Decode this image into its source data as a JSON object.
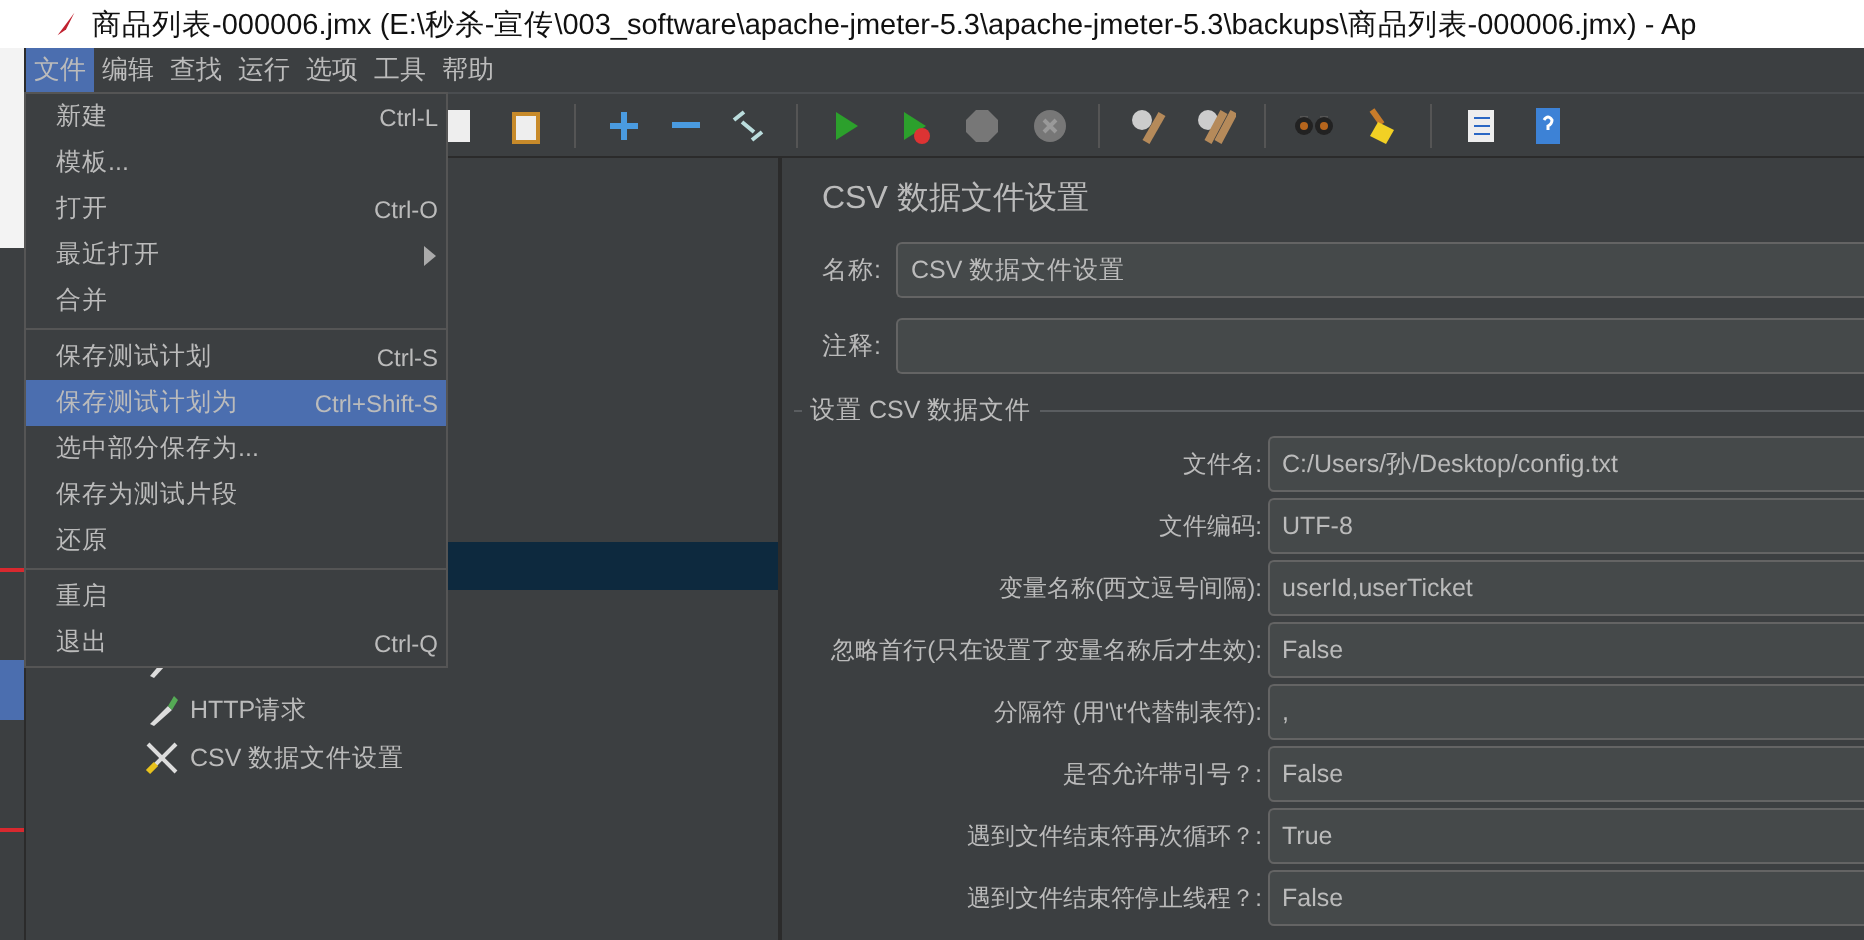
{
  "window": {
    "title": "商品列表-000006.jmx (E:\\秒杀-宣传\\003_software\\apache-jmeter-5.3\\apache-jmeter-5.3\\backups\\商品列表-000006.jmx) - Ap"
  },
  "menubar": [
    {
      "label": "文件",
      "selected": true
    },
    {
      "label": "编辑",
      "selected": false
    },
    {
      "label": "查找",
      "selected": false
    },
    {
      "label": "运行",
      "selected": false
    },
    {
      "label": "选项",
      "selected": false
    },
    {
      "label": "工具",
      "selected": false
    },
    {
      "label": "帮助",
      "selected": false
    }
  ],
  "file_menu": [
    [
      {
        "label": "新建",
        "shortcut": "Ctrl-L",
        "selected": false
      },
      {
        "label": "模板...",
        "selected": false
      },
      {
        "label": "打开",
        "shortcut": "Ctrl-O",
        "selected": false
      },
      {
        "label": "最近打开",
        "submenu": true,
        "selected": false
      },
      {
        "label": "合并",
        "selected": false
      }
    ],
    [
      {
        "label": "保存测试计划",
        "shortcut": "Ctrl-S",
        "selected": false
      },
      {
        "label": "保存测试计划为",
        "shortcut": "Ctrl+Shift-S",
        "selected": true
      },
      {
        "label": "选中部分保存为...",
        "selected": false
      },
      {
        "label": "保存为测试片段",
        "selected": false
      },
      {
        "label": "还原",
        "selected": false
      }
    ],
    [
      {
        "label": "重启",
        "selected": false
      },
      {
        "label": "退出",
        "shortcut": "Ctrl-Q",
        "selected": false
      }
    ]
  ],
  "tree": [
    {
      "kind": "blank",
      "selected": true
    },
    {
      "kind": "pencil",
      "selected": false
    },
    {
      "kind": "dropper",
      "label": "HTTP请求",
      "selected": false
    },
    {
      "kind": "tools",
      "label": "CSV 数据文件设置",
      "selected": false
    }
  ],
  "panel": {
    "title": "CSV 数据文件设置",
    "name_label": "名称:",
    "name_value": "CSV 数据文件设置",
    "comment_label": "注释:",
    "section": "设置 CSV 数据文件",
    "fields": [
      {
        "label": "文件名:",
        "value": "C:/Users/孙/Desktop/config.txt"
      },
      {
        "label": "文件编码:",
        "value": "UTF-8"
      },
      {
        "label": "变量名称(西文逗号间隔):",
        "value": "userId,userTicket"
      },
      {
        "label": "忽略首行(只在设置了变量名称后才生效):",
        "value": "False"
      },
      {
        "label": "分隔符 (用'\\t'代替制表符):",
        "value": ","
      },
      {
        "label": "是否允许带引号？:",
        "value": "False"
      },
      {
        "label": "遇到文件结束符再次循环？:",
        "value": "True"
      },
      {
        "label": "遇到文件结束符停止线程？:",
        "value": "False"
      }
    ]
  }
}
